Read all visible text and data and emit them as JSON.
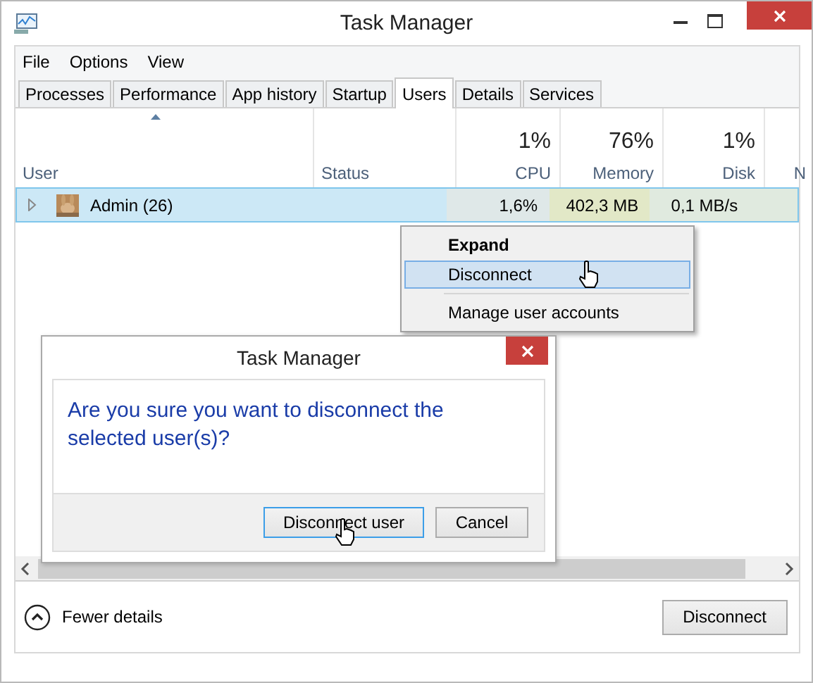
{
  "window": {
    "title": "Task Manager"
  },
  "menu": [
    "File",
    "Options",
    "View"
  ],
  "tabs": [
    {
      "label": "Processes",
      "selected": false
    },
    {
      "label": "Performance",
      "selected": false
    },
    {
      "label": "App history",
      "selected": false
    },
    {
      "label": "Startup",
      "selected": false
    },
    {
      "label": "Users",
      "selected": true
    },
    {
      "label": "Details",
      "selected": false
    },
    {
      "label": "Services",
      "selected": false
    }
  ],
  "table": {
    "columns": [
      {
        "label": "User",
        "sorted": true
      },
      {
        "label": "Status",
        "sorted": false
      },
      {
        "label": "CPU",
        "percent": "1%",
        "sorted": false
      },
      {
        "label": "Memory",
        "percent": "76%",
        "sorted": false
      },
      {
        "label": "Disk",
        "percent": "1%",
        "sorted": false
      },
      {
        "label": "N",
        "sorted": false
      }
    ],
    "rows": [
      {
        "user": "Admin (26)",
        "expanded": false,
        "selected": true,
        "values": [
          "1,6%",
          "402,3 MB",
          "0,1 MB/s"
        ]
      }
    ]
  },
  "context_menu": [
    {
      "label": "Expand",
      "default": true,
      "selected": false,
      "separator_before": false
    },
    {
      "label": "Disconnect",
      "default": false,
      "selected": true,
      "separator_before": false
    },
    {
      "label": "Manage user accounts",
      "default": false,
      "selected": false,
      "separator_before": true
    }
  ],
  "dialog": {
    "title": "Task Manager",
    "message": "Are you sure you want to disconnect the selected user(s)?",
    "buttons": [
      {
        "label": "Disconnect user",
        "default": true
      },
      {
        "label": "Cancel",
        "default": false
      }
    ]
  },
  "footer": {
    "toggle": "Fewer details",
    "button": "Disconnect"
  }
}
